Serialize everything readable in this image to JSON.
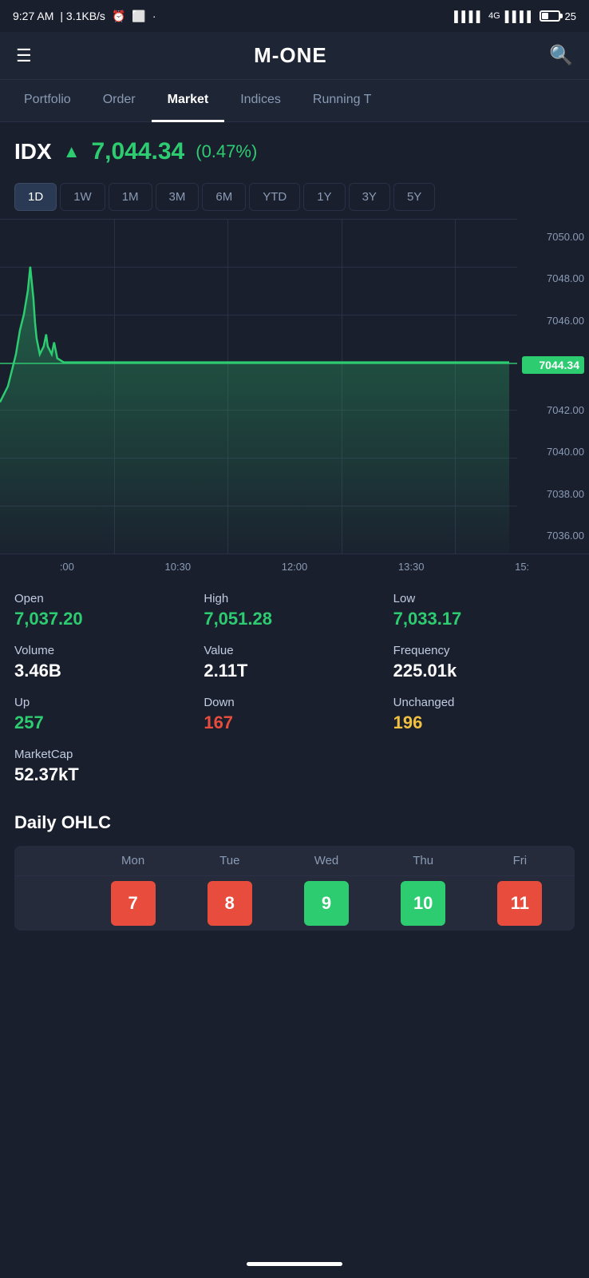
{
  "statusBar": {
    "time": "9:27 AM",
    "network": "3.1KB/s",
    "battery": "25"
  },
  "header": {
    "title": "M-ONE",
    "hamburgerLabel": "☰",
    "searchLabel": "🔍"
  },
  "nav": {
    "tabs": [
      {
        "label": "Portfolio",
        "active": false
      },
      {
        "label": "Order",
        "active": false
      },
      {
        "label": "Market",
        "active": true
      },
      {
        "label": "Indices",
        "active": false
      },
      {
        "label": "Running T",
        "active": false
      }
    ]
  },
  "idx": {
    "label": "IDX",
    "arrow": "▲",
    "value": "7,044.34",
    "percent": "(0.47%)"
  },
  "periods": [
    "1D",
    "1W",
    "1M",
    "3M",
    "6M",
    "YTD",
    "1Y",
    "3Y",
    "5Y"
  ],
  "activePeriod": "1D",
  "chart": {
    "yLabels": [
      "7050.00",
      "7048.00",
      "7046.00",
      "7044.34",
      "7042.00",
      "7040.00",
      "7038.00",
      "7036.00"
    ],
    "currentPrice": "7044.34",
    "xLabels": [
      "10:30",
      "12:00",
      "13:30",
      "15:"
    ]
  },
  "stats": [
    {
      "label": "Open",
      "value": "7,037.20",
      "color": "green"
    },
    {
      "label": "High",
      "value": "7,051.28",
      "color": "green"
    },
    {
      "label": "Low",
      "value": "7,033.17",
      "color": "green"
    },
    {
      "label": "Volume",
      "value": "3.46B",
      "color": "white"
    },
    {
      "label": "Value",
      "value": "2.11T",
      "color": "white"
    },
    {
      "label": "Frequency",
      "value": "225.01k",
      "color": "white"
    },
    {
      "label": "Up",
      "value": "257",
      "color": "green"
    },
    {
      "label": "Down",
      "value": "167",
      "color": "red"
    },
    {
      "label": "Unchanged",
      "value": "196",
      "color": "yellow"
    },
    {
      "label": "MarketCap",
      "value": "52.37kT",
      "color": "white"
    }
  ],
  "ohlc": {
    "title": "Daily OHLC",
    "headers": [
      "Mon",
      "Tue",
      "Wed",
      "Thu",
      "Fri"
    ],
    "dates": [
      {
        "date": "7",
        "color": "red"
      },
      {
        "date": "8",
        "color": "red"
      },
      {
        "date": "9",
        "color": "green"
      },
      {
        "date": "10",
        "color": "green"
      },
      {
        "date": "11",
        "color": "red"
      }
    ]
  }
}
